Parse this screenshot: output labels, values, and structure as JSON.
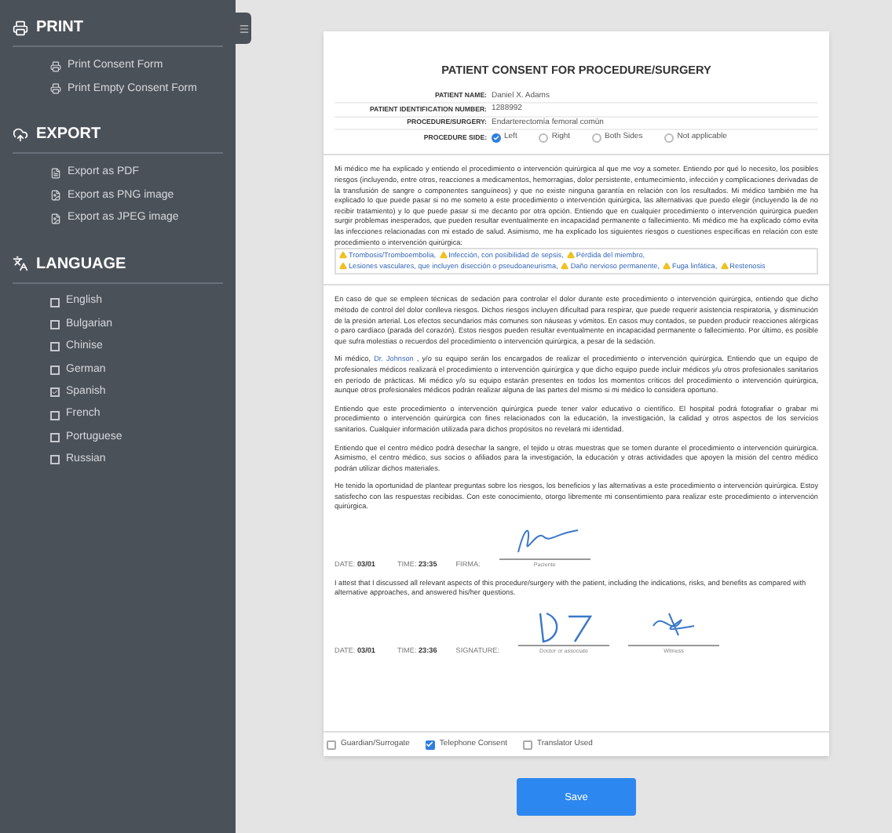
{
  "sidebar": {
    "sections": [
      {
        "kind": "print",
        "title": "PRINT",
        "items": [
          {
            "label": "Print Consent Form"
          },
          {
            "label": "Print Empty Consent Form"
          }
        ]
      },
      {
        "kind": "export",
        "title": "EXPORT",
        "items": [
          {
            "label": "Export as PDF"
          },
          {
            "label": "Export as PNG image"
          },
          {
            "label": "Export as JPEG image"
          }
        ]
      },
      {
        "kind": "language",
        "title": "LANGUAGE",
        "items": [
          {
            "label": "English",
            "checked": false
          },
          {
            "label": "Bulgarian",
            "checked": false
          },
          {
            "label": "Chinise",
            "checked": false
          },
          {
            "label": "German",
            "checked": false
          },
          {
            "label": "Spanish",
            "checked": true
          },
          {
            "label": "French",
            "checked": false
          },
          {
            "label": "Portuguese",
            "checked": false
          },
          {
            "label": "Russian",
            "checked": false
          }
        ]
      }
    ]
  },
  "document": {
    "title": "PATIENT CONSENT FOR PROCEDURE/SURGERY",
    "fields": [
      {
        "label": "PATIENT NAME:",
        "value": "Daniel X. Adams"
      },
      {
        "label": "PATIENT IDENTIFICATION NUMBER:",
        "value": "1288992"
      },
      {
        "label": "PROCEDURE/SURGERY:",
        "value": "Endarterectomía femoral común"
      }
    ],
    "procedure_side": {
      "label": "PROCEDURE SIDE:",
      "options": [
        {
          "label": "Left",
          "selected": true
        },
        {
          "label": "Right",
          "selected": false
        },
        {
          "label": "Both Sides",
          "selected": false
        },
        {
          "label": "Not applicable",
          "selected": false
        }
      ]
    },
    "consent_text": "Mi médico me ha explicado y entiendo el procedimiento o intervención quirúrgica al que me voy a someter. Entiendo por qué lo necesito, los posibles riesgos (incluyendo, entre otros, reacciones a medicamentos, hemorragias, dolor persistente, entumecimiento, infección y complicaciones derivadas de la transfusión de sangre o componentes sanguíneos) y que no existe ninguna garantía en relación con los resultados. Mi médico también me ha explicado lo que puede pasar si no me someto a este procedimiento o intervención quirúrgica, las alternativas que puedo elegir (incluyendo la de no recibir tratamiento) y lo que puede pasar si me decanto por otra opción. Entiendo que en cualquier procedimiento o intervención quirúrgica pueden surgir problemas inesperados, que pueden resultar eventualmente en incapacidad permanente o fallecimiento. Mi médico me ha explicado cómo evita las infecciones relacionadas con mi estado de salud. Asimismo, me ha explicado los siguientes riesgos o cuestiones específicas en relación con este procedimiento o intervención quirúrgica:",
    "risks": [
      "Trombosis/Tromboembolia,",
      "Infección, con posibilidad de sepsis,",
      "Pérdida del miembro,",
      "Lesiones vasculares, que incluyen disección o pseudoaneurisma,",
      "Daño nervioso permanente,",
      "Fuga linfática,",
      "Restenosis"
    ],
    "paragraphs": [
      {
        "kind": "text",
        "text": "En caso de que se empleen técnicas de sedación para controlar el dolor durante este procedimiento o intervención quirúrgica, entiendo que dicho método de control del dolor conlleva riesgos. Dichos riesgos incluyen dificultad para respirar, que puede requerir asistencia respiratoria, y disminución de la presión arterial. Los efectos secundarios más comunes son náuseas y vómitos. En casos muy contados, se pueden producir reacciones alérgicas o paro cardíaco (parada del corazón). Estos riesgos pueden resultar eventualmente en incapacidad permanente o fallecimiento. Por último, es posible que sufra molestias o recuerdos del procedimiento o intervención quirúrgica, a pesar de la sedación."
      },
      {
        "kind": "doctor",
        "before": "Mi médico,",
        "link": "Dr. Johnson",
        "after": ", y/o su equipo serán los encargados de realizar el procedimiento o intervención quirúrgica. Entiendo que un equipo de profesionales médicos realizará el procedimiento o intervención quirúrgica y que dicho equipo puede incluir médicos y/u otros profesionales sanitarios en período de prácticas. Mi médico y/o su equipo estarán presentes en todos los momentos críticos del procedimiento o intervención quirúrgica, aunque otros profesionales médicos podrán realizar alguna de las partes del mismo si mi médico lo considera oportuno."
      },
      {
        "kind": "text",
        "text": "Entiendo que este procedimiento o intervención quirúrgica puede tener valor educativo o científico. El hospital podrá fotografiar o grabar mi procedimiento o intervención quirúrgica con fines relacionados con la educación, la investigación, la calidad y otros aspectos de los servicios sanitarios. Cualquier información utilizada para dichos propósitos no revelará mi identidad."
      },
      {
        "kind": "text",
        "text": "Entiendo que el centro médico podrá desechar la sangre, el tejido u otras muestras que se tomen durante el procedimiento o intervención quirúrgica. Asimismo, el centro médico, sus socios o afiliados para la investigación, la educación y otras actividades que apoyen la misión del centro médico podrán utilizar dichos materiales."
      },
      {
        "kind": "text",
        "text": "He tenido la oportunidad de plantear preguntas sobre los riesgos, los beneficios y las alternativas a este procedimiento o intervención quirúrgica. Estoy satisfecho con las respuestas recibidas. Con este conocimiento, otorgo libremente mi consentimiento para realizar este procedimiento o intervención quirúrgica."
      }
    ],
    "patient_signoff": {
      "date_label": "DATE:",
      "date": "03/01",
      "time_label": "TIME:",
      "time": "23:35",
      "signature_label": "FIRMA:",
      "signers": [
        {
          "caption": "Paciente"
        }
      ]
    },
    "attestation": "I attest that I discussed all relevant aspects of this procedure/surgery with the patient, including the indications, risks, and benefits as compared with alternative approaches, and answered his/her questions.",
    "doctor_signoff": {
      "date_label": "DATE:",
      "date": "03/01",
      "time_label": "TIME:",
      "time": "23:36",
      "signature_label": "SIGNATURE:",
      "signers": [
        {
          "caption": "Doctor or associate"
        },
        {
          "caption": "Witness"
        }
      ]
    },
    "options": [
      {
        "label": "Guardian/Surrogate",
        "checked": false
      },
      {
        "label": "Telephone Consent",
        "checked": true
      },
      {
        "label": "Translator Used",
        "checked": false
      }
    ]
  },
  "save_button": "Save"
}
